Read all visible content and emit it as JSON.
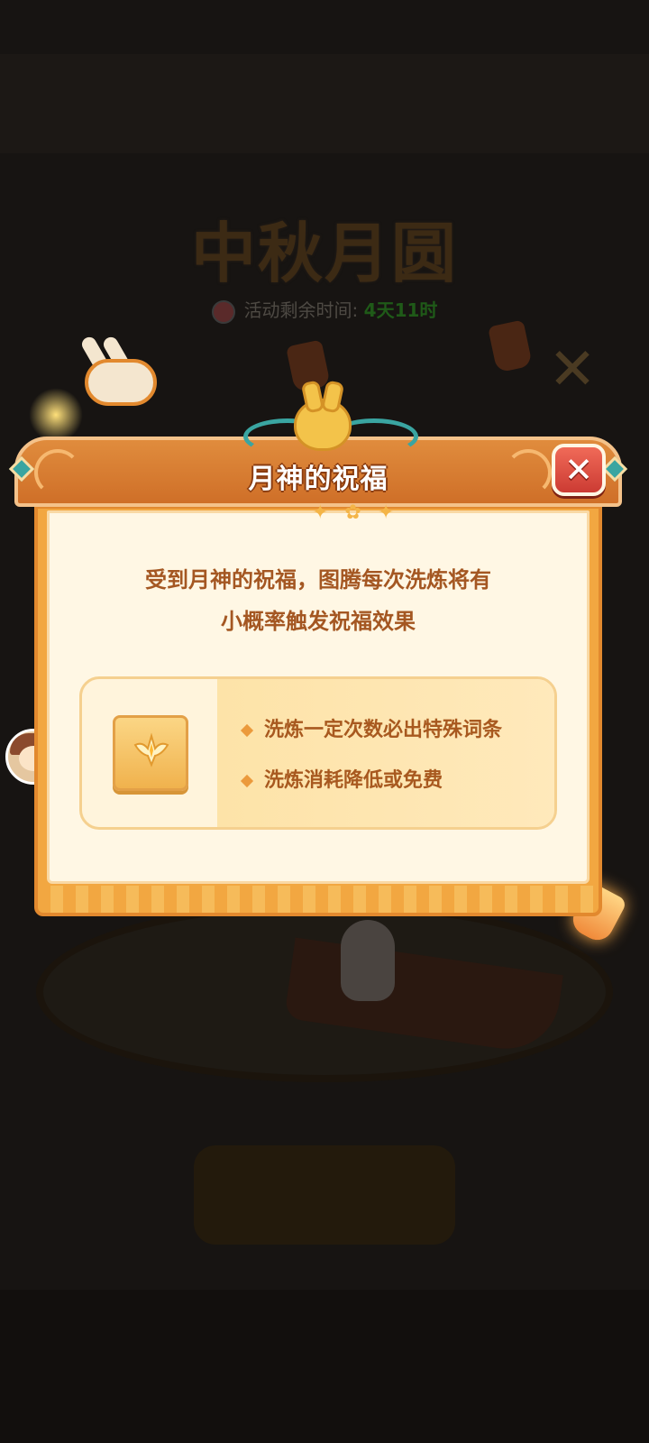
{
  "background": {
    "event_title": "中秋月圆",
    "timer_label": "活动剩余时间:",
    "timer_value": "4天11时"
  },
  "modal": {
    "title": "月神的祝福",
    "close_symbol": "✕",
    "description_lines": [
      "受到月神的祝福，图腾每次洗炼将有",
      "小概率触发祝福效果"
    ],
    "item_icon": "winged-star-icon",
    "effects": [
      "洗炼一定次数必出特殊词条",
      "洗炼消耗降低或免费"
    ]
  },
  "colors": {
    "header": "#cf6f28",
    "body_border": "#f2a741",
    "panel": "#fff7e4",
    "text": "#a45722",
    "close_button": "#cc3b33",
    "accent_teal": "#3aa5a1"
  }
}
